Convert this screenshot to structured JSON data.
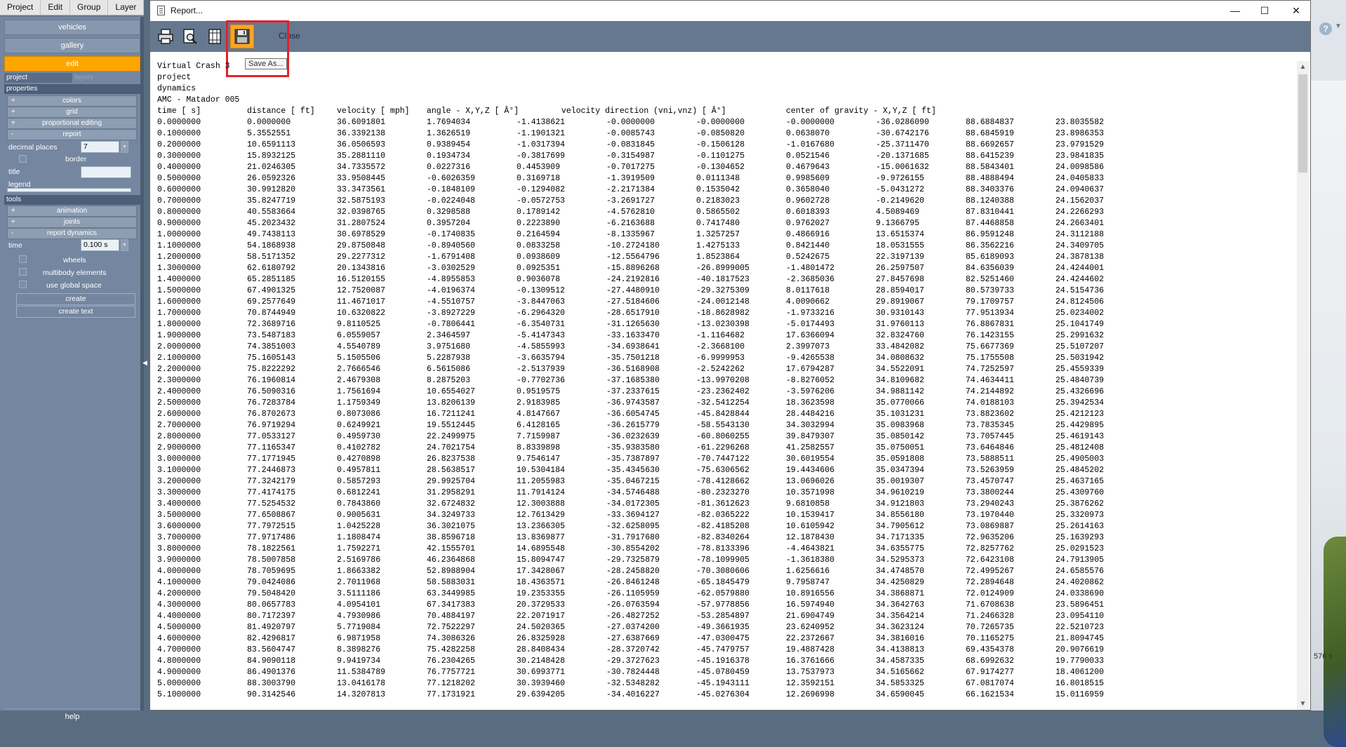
{
  "menu": [
    "Project",
    "Edit",
    "Group",
    "Layer"
  ],
  "side": {
    "vehicles": "vehicles",
    "gallery": "gallery",
    "edit": "edit",
    "tab_project": "project",
    "tab_layers": "layers",
    "properties": "properties",
    "colors": "colors",
    "grid": "grid",
    "proportional_editing": "proportional editing",
    "report": "report",
    "decimal_places_label": "decimal places",
    "decimal_places_value": "7",
    "border": "border",
    "title_label": "title",
    "legend_label": "legend",
    "tools": "tools",
    "animation": "animation",
    "joints": "joints",
    "report_dynamics": "report dynamics",
    "time_label": "time",
    "time_value": "0.100 s",
    "wheels": "wheels",
    "multibody": "multibody elements",
    "global_space": "use global space",
    "create": "create",
    "create_text": "create text",
    "help": "help",
    "plus": "+",
    "minus": "-"
  },
  "right": {
    "help": "?",
    "time_text": "576 s"
  },
  "dialog": {
    "title": "Report...",
    "close_label": "Close",
    "tooltip": "Save As...",
    "minimize": "—",
    "maximize": "☐",
    "close_x": "✕"
  },
  "report": {
    "header_lines": [
      "Virtual Crash 3",
      "project",
      "dynamics",
      "AMC - Matador 005"
    ],
    "columns": [
      "time [ s]",
      "distance [ ft]",
      "velocity [ mph]",
      "angle - X,Y,Z [ Â°]",
      "velocity direction (vni,vnz) [ Â°]",
      "center of gravity - X,Y,Z [ ft]"
    ],
    "rows": [
      [
        "0.0000000",
        "0.0000000",
        "36.6091801",
        "1.7694034",
        "-1.4138621",
        "-0.0000000",
        "-0.0000000",
        "-0.0000000",
        "-36.0286090",
        "88.6884837",
        "23.8035582"
      ],
      [
        "0.1000000",
        "5.3552551",
        "36.3392138",
        "1.3626519",
        "-1.1901321",
        "-0.0085743",
        "-0.0850820",
        "0.0638070",
        "-30.6742176",
        "88.6845919",
        "23.8986353"
      ],
      [
        "0.2000000",
        "10.6591113",
        "36.0506593",
        "0.9389454",
        "-1.0317394",
        "-0.0831845",
        "-0.1506128",
        "-1.0167680",
        "-25.3711470",
        "88.6692657",
        "23.9791529"
      ],
      [
        "0.3000000",
        "15.8932125",
        "35.2881110",
        "0.1934734",
        "-0.3817699",
        "-0.3154987",
        "-0.1101275",
        "0.0521546",
        "-20.1371685",
        "88.6415239",
        "23.9841835"
      ],
      [
        "0.4000000",
        "21.0246305",
        "34.7335572",
        "0.0227316",
        "0.4453909",
        "-0.7017275",
        "-0.1304652",
        "0.4679643",
        "-15.0061632",
        "88.5843401",
        "24.0098586"
      ],
      [
        "0.5000000",
        "26.0592326",
        "33.9508445",
        "-0.6026359",
        "0.3169718",
        "-1.3919509",
        "0.0111348",
        "0.9985609",
        "-9.9726155",
        "88.4888494",
        "24.0405833"
      ],
      [
        "0.6000000",
        "30.9912820",
        "33.3473561",
        "-0.1848109",
        "-0.1294082",
        "-2.2171384",
        "0.1535042",
        "0.3658040",
        "-5.0431272",
        "88.3403376",
        "24.0940637"
      ],
      [
        "0.7000000",
        "35.8247719",
        "32.5875193",
        "-0.0224048",
        "-0.0572753",
        "-3.2691727",
        "0.2183023",
        "0.9602728",
        "-0.2149620",
        "88.1240388",
        "24.1562037"
      ],
      [
        "0.8000000",
        "40.5583664",
        "32.0398765",
        "0.3298588",
        "0.1789142",
        "-4.5762810",
        "0.5865502",
        "0.6018393",
        "4.5089469",
        "87.8310441",
        "24.2266293"
      ],
      [
        "0.9000000",
        "45.2023432",
        "31.2807524",
        "0.3957204",
        "0.2223890",
        "-6.2163688",
        "0.7417480",
        "0.9762027",
        "9.1366795",
        "87.4468858",
        "24.2663401"
      ],
      [
        "1.0000000",
        "49.7438113",
        "30.6978529",
        "-0.1740835",
        "0.2164594",
        "-8.1335967",
        "1.3257257",
        "0.4866916",
        "13.6515374",
        "86.9591248",
        "24.3112188"
      ],
      [
        "1.1000000",
        "54.1868938",
        "29.8750848",
        "-0.8940560",
        "0.0833258",
        "-10.2724180",
        "1.4275133",
        "0.8421440",
        "18.0531555",
        "86.3562216",
        "24.3409705"
      ],
      [
        "1.2000000",
        "58.5171352",
        "29.2277312",
        "-1.6791408",
        "0.0938609",
        "-12.5564796",
        "1.8523864",
        "0.5242675",
        "22.3197139",
        "85.6189093",
        "24.3878138"
      ],
      [
        "1.3000000",
        "62.6180792",
        "20.1343816",
        "-3.0302529",
        "0.0925351",
        "-15.8896268",
        "-26.8999005",
        "-1.4801472",
        "26.2597507",
        "84.6356039",
        "24.4244001"
      ],
      [
        "1.4000000",
        "65.2851185",
        "16.5120155",
        "-4.8955853",
        "0.9036078",
        "-24.2192816",
        "-40.1817523",
        "-2.3685036",
        "27.8457698",
        "82.5251460",
        "24.4244602"
      ],
      [
        "1.5000000",
        "67.4901325",
        "12.7520087",
        "-4.0196374",
        "-0.1309512",
        "-27.4480910",
        "-29.3275309",
        "8.0117618",
        "28.8594017",
        "80.5739733",
        "24.5154736"
      ],
      [
        "1.6000000",
        "69.2577649",
        "11.4671017",
        "-4.5510757",
        "-3.8447063",
        "-27.5184606",
        "-24.0012148",
        "4.0090662",
        "29.8919067",
        "79.1709757",
        "24.8124506"
      ],
      [
        "1.7000000",
        "70.8744949",
        "10.6320822",
        "-3.8927229",
        "-6.2964320",
        "-28.6517910",
        "-18.8628982",
        "-1.9733216",
        "30.9310143",
        "77.9513934",
        "25.0234002"
      ],
      [
        "1.8000000",
        "72.3689716",
        "9.8110525",
        "-0.7806441",
        "-6.3540731",
        "-31.1265630",
        "-13.0230398",
        "-5.0174493",
        "31.9760113",
        "76.8867831",
        "25.1041749"
      ],
      [
        "1.9000000",
        "73.5487183",
        "6.0559057",
        "2.3464597",
        "-5.4147343",
        "-33.1633470",
        "-1.1164682",
        "17.6366094",
        "32.8324760",
        "76.1423155",
        "25.2991632"
      ],
      [
        "2.0000000",
        "74.3851003",
        "4.5540789",
        "3.9751680",
        "-4.5855993",
        "-34.6938641",
        "-2.3668100",
        "2.3997073",
        "33.4842082",
        "75.6677369",
        "25.5107207"
      ],
      [
        "2.1000000",
        "75.1605143",
        "5.1505506",
        "5.2287938",
        "-3.6635794",
        "-35.7501218",
        "-6.9999953",
        "-9.4265538",
        "34.0808632",
        "75.1755508",
        "25.5031942"
      ],
      [
        "2.2000000",
        "75.8222292",
        "2.7666546",
        "6.5615086",
        "-2.5137939",
        "-36.5168908",
        "-2.5242262",
        "17.6794287",
        "34.5522091",
        "74.7252597",
        "25.4559339"
      ],
      [
        "2.3000000",
        "76.1960814",
        "2.4679308",
        "8.2875203",
        "-0.7702736",
        "-37.1685380",
        "-13.9970208",
        "-8.8276052",
        "34.8109682",
        "74.4634411",
        "25.4840739"
      ],
      [
        "2.4000000",
        "76.5090316",
        "1.7561694",
        "10.6554027",
        "0.9519575",
        "-37.2337615",
        "-23.2362402",
        "-3.5976206",
        "34.9881142",
        "74.2144892",
        "25.4326696"
      ],
      [
        "2.5000000",
        "76.7283784",
        "1.1759349",
        "13.8206139",
        "2.9183985",
        "-36.9743587",
        "-32.5412254",
        "18.3623598",
        "35.0770066",
        "74.0188103",
        "25.3942534"
      ],
      [
        "2.6000000",
        "76.8702673",
        "0.8073086",
        "16.7211241",
        "4.8147667",
        "-36.6054745",
        "-45.8428844",
        "28.4484216",
        "35.1031231",
        "73.8823602",
        "25.4212123"
      ],
      [
        "2.7000000",
        "76.9719294",
        "0.6249921",
        "19.5512445",
        "6.4128165",
        "-36.2615779",
        "-58.5543130",
        "34.3032994",
        "35.0983968",
        "73.7835345",
        "25.4429895"
      ],
      [
        "2.8000000",
        "77.0533127",
        "0.4959730",
        "22.2499975",
        "7.7159987",
        "-36.0232639",
        "-60.8060255",
        "39.8479307",
        "35.0850142",
        "73.7057445",
        "25.4619143"
      ],
      [
        "2.9000000",
        "77.1165347",
        "0.4102782",
        "24.7021754",
        "8.8339898",
        "-35.9383580",
        "-61.2296268",
        "41.2582557",
        "35.0750051",
        "73.6464846",
        "25.4812408"
      ],
      [
        "3.0000000",
        "77.1771945",
        "0.4270898",
        "26.8237538",
        "9.7546147",
        "-35.7387897",
        "-70.7447122",
        "30.6019554",
        "35.0591808",
        "73.5888511",
        "25.4905003"
      ],
      [
        "3.1000000",
        "77.2446873",
        "0.4957811",
        "28.5638517",
        "10.5304184",
        "-35.4345630",
        "-75.6306562",
        "19.4434606",
        "35.0347394",
        "73.5263959",
        "25.4845202"
      ],
      [
        "3.2000000",
        "77.3242179",
        "0.5857293",
        "29.9925704",
        "11.2055983",
        "-35.0467215",
        "-78.4128662",
        "13.0696026",
        "35.0019307",
        "73.4570747",
        "25.4637165"
      ],
      [
        "3.3000000",
        "77.4174175",
        "0.6812241",
        "31.2958291",
        "11.7914124",
        "-34.5746488",
        "-80.2323270",
        "10.3571998",
        "34.9610219",
        "73.3800244",
        "25.4309760"
      ],
      [
        "3.4000000",
        "77.5254532",
        "0.7843860",
        "32.6724832",
        "12.3003888",
        "-34.0172305",
        "-81.3612623",
        "9.6810858",
        "34.9121803",
        "73.2940243",
        "25.3876262"
      ],
      [
        "3.5000000",
        "77.6508867",
        "0.9005631",
        "34.3249733",
        "12.7613429",
        "-33.3694127",
        "-82.0365222",
        "10.1539417",
        "34.8556180",
        "73.1970440",
        "25.3320973"
      ],
      [
        "3.6000000",
        "77.7972515",
        "1.0425228",
        "36.3021075",
        "13.2366305",
        "-32.6258095",
        "-82.4185208",
        "10.6105942",
        "34.7905612",
        "73.0869887",
        "25.2614163"
      ],
      [
        "3.7000000",
        "77.9717486",
        "1.1808474",
        "38.8596718",
        "13.8369877",
        "-31.7917680",
        "-82.8340264",
        "12.1878430",
        "34.7171335",
        "72.9635206",
        "25.1639293"
      ],
      [
        "3.8000000",
        "78.1822561",
        "1.7592271",
        "42.1555701",
        "14.6895548",
        "-30.8554202",
        "-78.8133396",
        "-4.4643821",
        "34.6355775",
        "72.8257762",
        "25.0291523"
      ],
      [
        "3.9000000",
        "78.5007858",
        "2.5169786",
        "46.2364868",
        "15.8094747",
        "-29.7325879",
        "-78.1099905",
        "-1.3618380",
        "34.5295373",
        "72.6423108",
        "24.7913905"
      ],
      [
        "4.0000000",
        "78.7059695",
        "1.8663382",
        "52.8988904",
        "17.3428067",
        "-28.2458820",
        "-70.3080606",
        "1.6256616",
        "34.4748570",
        "72.4995267",
        "24.6585576"
      ],
      [
        "4.1000000",
        "79.0424086",
        "2.7011968",
        "58.5883031",
        "18.4363571",
        "-26.8461248",
        "-65.1845479",
        "9.7958747",
        "34.4250829",
        "72.2894648",
        "24.4020862"
      ],
      [
        "4.2000000",
        "79.5048420",
        "3.5111186",
        "63.3449985",
        "19.2353355",
        "-26.1105959",
        "-62.0579880",
        "10.8916556",
        "34.3868871",
        "72.0124909",
        "24.0338690"
      ],
      [
        "4.3000000",
        "80.0657783",
        "4.0954101",
        "67.3417383",
        "20.3729533",
        "-26.0763594",
        "-57.9778856",
        "16.5974940",
        "34.3642763",
        "71.6708638",
        "23.5896451"
      ],
      [
        "4.4000000",
        "80.7172397",
        "4.7930986",
        "70.4884197",
        "22.2071917",
        "-26.4827252",
        "-53.2854897",
        "21.6904749",
        "34.3564214",
        "71.2466328",
        "23.0954110"
      ],
      [
        "4.5000000",
        "81.4920797",
        "5.7719084",
        "72.7522297",
        "24.5020365",
        "-27.0374200",
        "-49.3661935",
        "23.6240952",
        "34.3623124",
        "70.7265735",
        "22.5210723"
      ],
      [
        "4.6000000",
        "82.4296817",
        "6.9871958",
        "74.3086326",
        "26.8325928",
        "-27.6387669",
        "-47.0300475",
        "22.2372667",
        "34.3816016",
        "70.1165275",
        "21.8094745"
      ],
      [
        "4.7000000",
        "83.5604747",
        "8.3898276",
        "75.4282258",
        "28.8408434",
        "-28.3720742",
        "-45.7479757",
        "19.4887428",
        "34.4138813",
        "69.4354378",
        "20.9076619"
      ],
      [
        "4.8000000",
        "84.9090118",
        "9.9419734",
        "76.2304265",
        "30.2148428",
        "-29.3727623",
        "-45.1916378",
        "16.3761666",
        "34.4587335",
        "68.6992632",
        "19.7790033"
      ],
      [
        "4.9000000",
        "86.4901376",
        "11.5384789",
        "76.7757721",
        "30.6993771",
        "-30.7824448",
        "-45.0780459",
        "13.7537973",
        "34.5165662",
        "67.9174277",
        "18.4061200"
      ],
      [
        "5.0000000",
        "88.3003790",
        "13.0416178",
        "77.1218202",
        "30.3939460",
        "-32.5348282",
        "-45.1943111",
        "12.3592151",
        "34.5853325",
        "67.0817074",
        "16.8018515"
      ],
      [
        "5.1000000",
        "90.3142546",
        "14.3207813",
        "77.1731921",
        "29.6394205",
        "-34.4016227",
        "-45.0276304",
        "12.2696998",
        "34.6590045",
        "66.1621534",
        "15.0116959"
      ]
    ]
  },
  "colors": {
    "accent": "#ffa500",
    "highlight": "#e3202a",
    "toolbar": "#66788f",
    "panel": "#7486a0"
  },
  "icons": [
    "print-icon",
    "print-preview-icon",
    "page-setup-icon",
    "save-icon"
  ]
}
